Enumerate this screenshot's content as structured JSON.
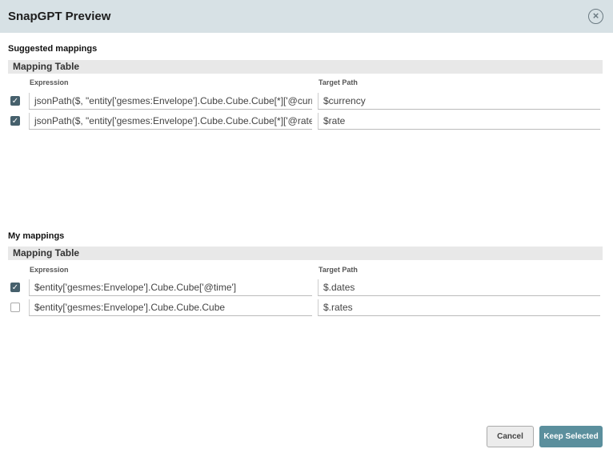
{
  "dialog": {
    "title": "SnapGPT Preview",
    "close_icon": "close-circle-icon"
  },
  "suggested": {
    "heading": "Suggested mappings",
    "table_title": "Mapping Table",
    "col_expression": "Expression",
    "col_target": "Target Path",
    "rows": [
      {
        "checked": true,
        "expression": "jsonPath($, \"entity['gesmes:Envelope'].Cube.Cube.Cube[*]['@currency']\")",
        "target": "$currency"
      },
      {
        "checked": true,
        "expression": "jsonPath($, \"entity['gesmes:Envelope'].Cube.Cube.Cube[*]['@rate']\")",
        "target": "$rate"
      }
    ]
  },
  "mine": {
    "heading": "My mappings",
    "table_title": "Mapping Table",
    "col_expression": "Expression",
    "col_target": "Target Path",
    "rows": [
      {
        "checked": true,
        "expression": "$entity['gesmes:Envelope'].Cube.Cube['@time']",
        "target": "$.dates"
      },
      {
        "checked": false,
        "expression": "$entity['gesmes:Envelope'].Cube.Cube.Cube",
        "target": "$.rates"
      }
    ]
  },
  "buttons": {
    "cancel": "Cancel",
    "keep": "Keep Selected"
  },
  "colors": {
    "accent": "#5b8f9d",
    "header": "#d7e1e5",
    "checkbox": "#46606c"
  }
}
